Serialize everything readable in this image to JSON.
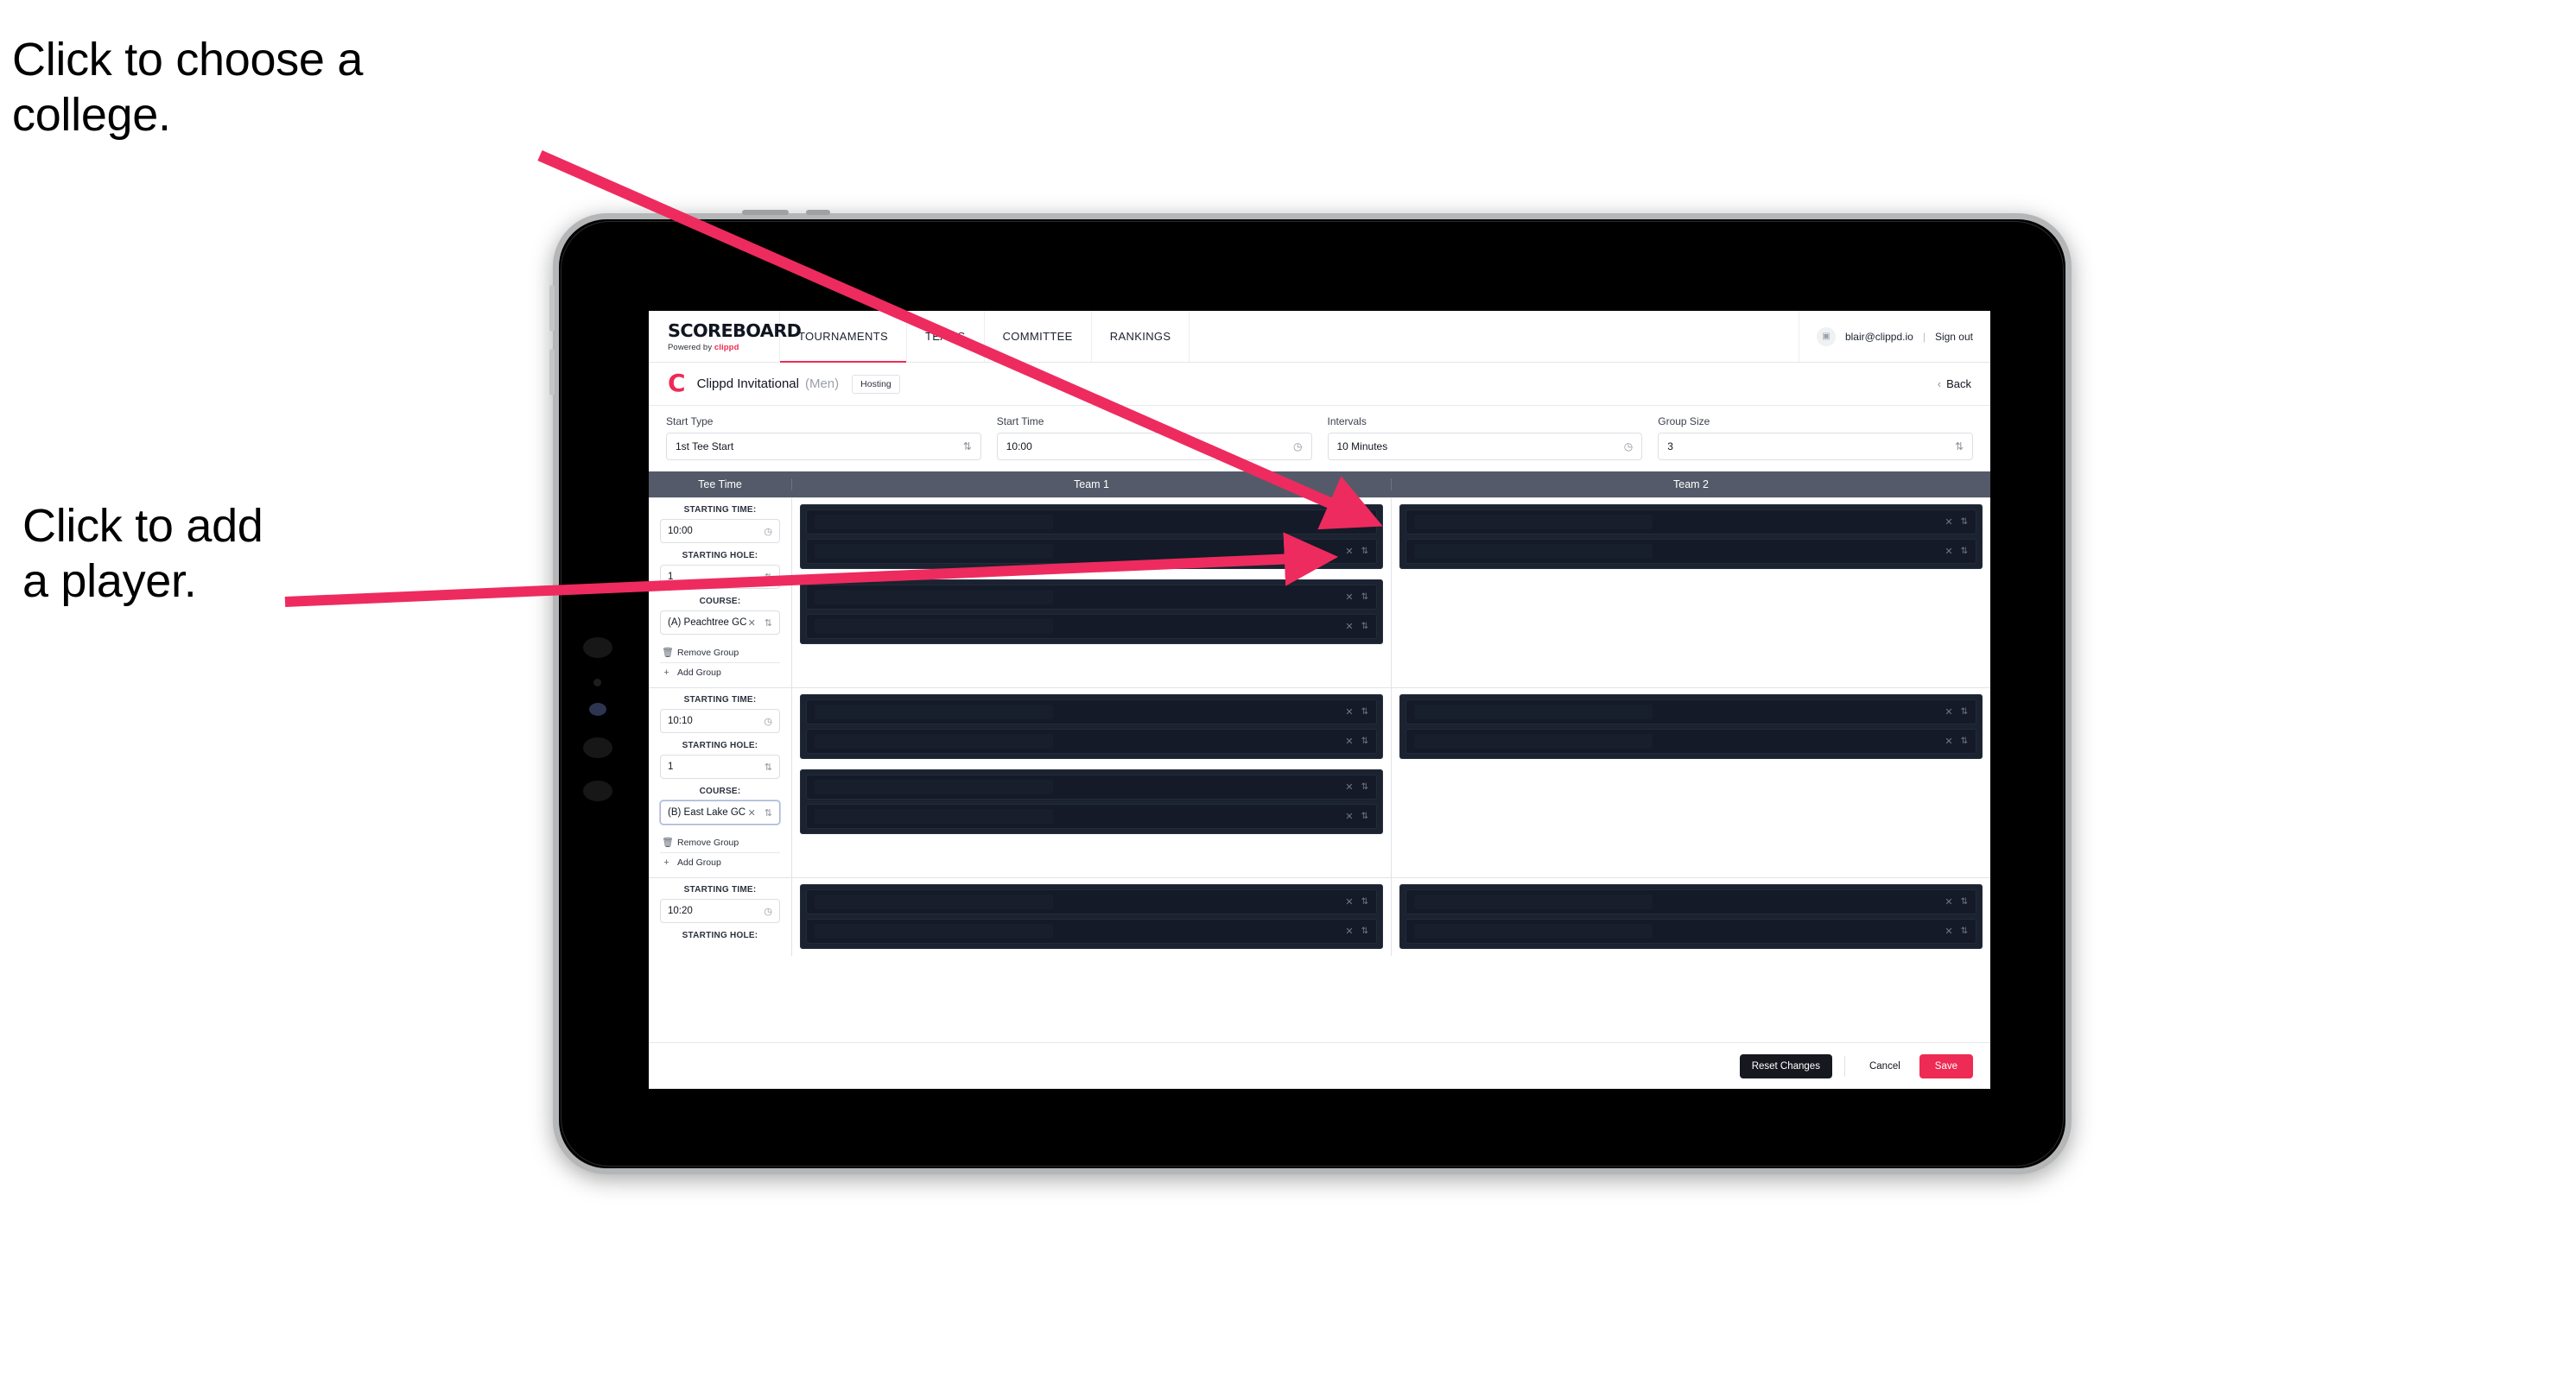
{
  "annotations": [
    {
      "id": "college",
      "text": "Click to choose a\ncollege."
    },
    {
      "id": "player",
      "text": "Click to add\na player."
    }
  ],
  "colors": {
    "accent": "#ee2b54",
    "arrow": "#ee2b5e",
    "table_header": "#545a69",
    "player_slot_bg": "#141a27",
    "group_box_bg": "#1b2230",
    "dark_button": "#15181e"
  },
  "nav": {
    "brand_main": "SCOREBOARD",
    "brand_sub_prefix": "Powered by ",
    "brand_sub_accent": "clippd",
    "links": [
      {
        "label": "TOURNAMENTS",
        "active": true
      },
      {
        "label": "TEAMS",
        "active": false
      },
      {
        "label": "COMMITTEE",
        "active": false
      },
      {
        "label": "RANKINGS",
        "active": false
      }
    ],
    "user_email": "blair@clippd.io",
    "separator": "|",
    "sign_out": "Sign out",
    "avatar_glyph": "▣"
  },
  "tournament": {
    "logo_letter": "C",
    "name": "Clippd Invitational",
    "gender": "(Men)",
    "badge": "Hosting",
    "back_label": "Back",
    "back_chevron": "‹"
  },
  "settings": [
    {
      "label": "Start Type",
      "value": "1st Tee Start",
      "indicator": "⇅",
      "indicator_name": "stepper-icon"
    },
    {
      "label": "Start Time",
      "value": "10:00",
      "indicator": "◷",
      "indicator_name": "clock-icon"
    },
    {
      "label": "Intervals",
      "value": "10 Minutes",
      "indicator": "◷",
      "indicator_name": "clock-icon"
    },
    {
      "label": "Group Size",
      "value": "3",
      "indicator": "⇅",
      "indicator_name": "stepper-icon"
    }
  ],
  "table": {
    "headers": [
      "Tee Time",
      "Team 1",
      "Team 2"
    ],
    "labels": {
      "starting_time": "STARTING TIME:",
      "starting_hole": "STARTING HOLE:",
      "course": "COURSE:",
      "remove_group": "Remove Group",
      "add_group": "Add Group",
      "remove_icon": "🗑",
      "add_icon": "+",
      "clear_icon": "✕",
      "clock_icon": "◷",
      "stepper_icon": "⇅"
    },
    "rows": [
      {
        "starting_time": "10:00",
        "starting_hole": "1",
        "course": "(A) Peachtree GC",
        "course_focused": false,
        "hole_visible": true,
        "course_visible": true,
        "actions_visible": true,
        "team1_groups": [
          {
            "slots": 2
          },
          {
            "slots": 2
          }
        ],
        "team2_groups": [
          {
            "slots": 2
          }
        ]
      },
      {
        "starting_time": "10:10",
        "starting_hole": "1",
        "course": "(B) East Lake GC",
        "course_focused": true,
        "hole_visible": true,
        "course_visible": true,
        "actions_visible": true,
        "team1_groups": [
          {
            "slots": 2
          },
          {
            "slots": 2
          }
        ],
        "team2_groups": [
          {
            "slots": 2
          }
        ]
      },
      {
        "starting_time": "10:20",
        "starting_hole": "",
        "course": "",
        "course_focused": false,
        "hole_visible": false,
        "course_visible": false,
        "actions_visible": false,
        "team1_groups": [
          {
            "slots": 2
          }
        ],
        "team2_groups": [
          {
            "slots": 2
          }
        ]
      }
    ]
  },
  "footer": {
    "reset": "Reset Changes",
    "cancel": "Cancel",
    "save": "Save"
  }
}
